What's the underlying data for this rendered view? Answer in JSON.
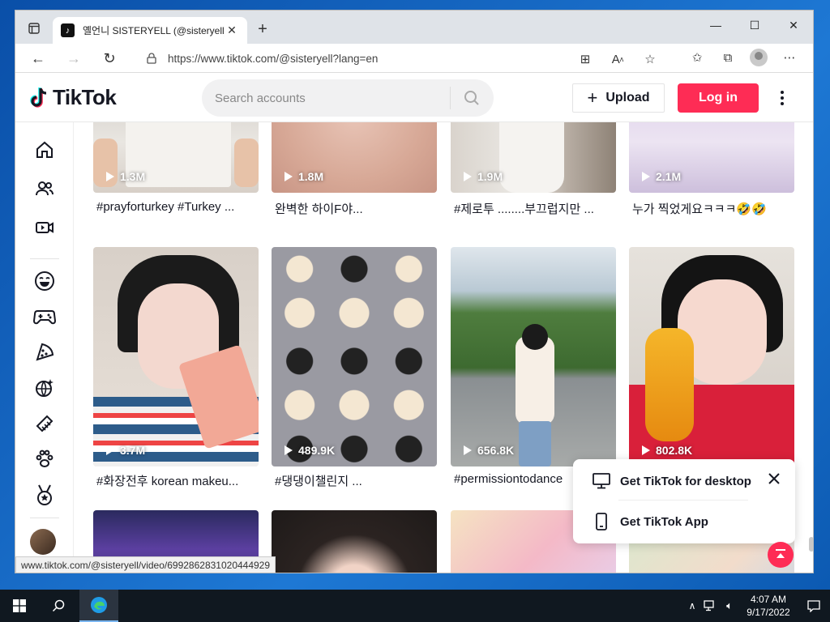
{
  "browser": {
    "tab_title": "옐언니 SISTERYELL (@sisteryell) | TikTok",
    "url": "https://www.tiktok.com/@sisteryell?lang=en",
    "status_link": "www.tiktok.com/@sisteryell/video/6992862831020444929"
  },
  "header": {
    "logo": "TikTok",
    "search_placeholder": "Search accounts",
    "upload_label": "Upload",
    "login_label": "Log in"
  },
  "sidebar": {
    "icons": [
      "home-icon",
      "following-icon",
      "live-icon",
      "comedy-icon",
      "gaming-icon",
      "food-icon",
      "travel-icon",
      "beauty-icon",
      "animals-icon",
      "sports-icon"
    ]
  },
  "videos": [
    {
      "views": "1.3M",
      "caption": "#prayforturkey #Turkey ..."
    },
    {
      "views": "1.8M",
      "caption": "완벽한 하이F야..."
    },
    {
      "views": "1.9M",
      "caption": "#제로투 ........부끄럽지만 ..."
    },
    {
      "views": "2.1M",
      "caption": "누가 찍었게요ㅋㅋㅋ🤣🤣"
    },
    {
      "views": "3.7M",
      "caption": "#화장전후 korean makeu..."
    },
    {
      "views": "489.9K",
      "caption": "#댕댕이챌린지 ..."
    },
    {
      "views": "656.8K",
      "caption": "#permissiontodance"
    },
    {
      "views": "802.8K",
      "caption": ""
    }
  ],
  "popup": {
    "desktop_label": "Get TikTok for desktop",
    "app_label": "Get TikTok App"
  },
  "taskbar": {
    "time": "4:07 AM",
    "date": "9/17/2022"
  },
  "colors": {
    "brand_red": "#fe2c55",
    "text_dark": "#161823"
  }
}
